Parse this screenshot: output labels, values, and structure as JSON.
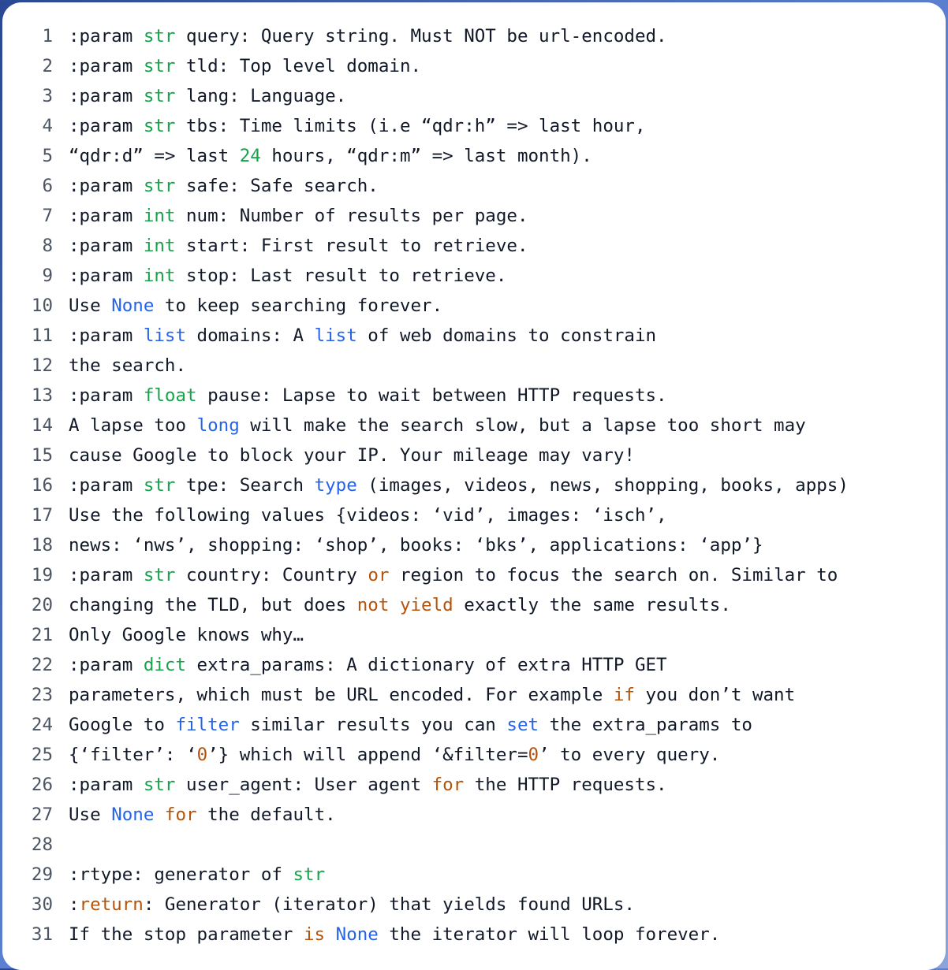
{
  "lines": [
    {
      "n": "1",
      "tokens": [
        {
          "t": ":param ",
          "c": ""
        },
        {
          "t": "str",
          "c": "tk-kw"
        },
        {
          "t": " query: Query string. Must NOT be url-encoded.",
          "c": ""
        }
      ]
    },
    {
      "n": "2",
      "tokens": [
        {
          "t": ":param ",
          "c": ""
        },
        {
          "t": "str",
          "c": "tk-kw"
        },
        {
          "t": " tld: Top level domain.",
          "c": ""
        }
      ]
    },
    {
      "n": "3",
      "tokens": [
        {
          "t": ":param ",
          "c": ""
        },
        {
          "t": "str",
          "c": "tk-kw"
        },
        {
          "t": " lang: Language.",
          "c": ""
        }
      ]
    },
    {
      "n": "4",
      "tokens": [
        {
          "t": ":param ",
          "c": ""
        },
        {
          "t": "str",
          "c": "tk-kw"
        },
        {
          "t": " tbs: Time limits (i.e “qdr:h” => last hour,",
          "c": ""
        }
      ]
    },
    {
      "n": "5",
      "tokens": [
        {
          "t": "“qdr:d” => last ",
          "c": ""
        },
        {
          "t": "24",
          "c": "tk-num"
        },
        {
          "t": " hours, “qdr:m” => last month).",
          "c": ""
        }
      ]
    },
    {
      "n": "6",
      "tokens": [
        {
          "t": ":param ",
          "c": ""
        },
        {
          "t": "str",
          "c": "tk-kw"
        },
        {
          "t": " safe: Safe search.",
          "c": ""
        }
      ]
    },
    {
      "n": "7",
      "tokens": [
        {
          "t": ":param ",
          "c": ""
        },
        {
          "t": "int",
          "c": "tk-kw"
        },
        {
          "t": " num: Number of results per page.",
          "c": ""
        }
      ]
    },
    {
      "n": "8",
      "tokens": [
        {
          "t": ":param ",
          "c": ""
        },
        {
          "t": "int",
          "c": "tk-kw"
        },
        {
          "t": " start: First result to retrieve.",
          "c": ""
        }
      ]
    },
    {
      "n": "9",
      "tokens": [
        {
          "t": ":param ",
          "c": ""
        },
        {
          "t": "int",
          "c": "tk-kw"
        },
        {
          "t": " stop: Last result to retrieve.",
          "c": ""
        }
      ]
    },
    {
      "n": "10",
      "tokens": [
        {
          "t": "Use ",
          "c": ""
        },
        {
          "t": "None",
          "c": "tk-none"
        },
        {
          "t": " to keep searching forever.",
          "c": ""
        }
      ]
    },
    {
      "n": "11",
      "tokens": [
        {
          "t": ":param ",
          "c": ""
        },
        {
          "t": "list",
          "c": "tk-builtin"
        },
        {
          "t": " domains: A ",
          "c": ""
        },
        {
          "t": "list",
          "c": "tk-builtin"
        },
        {
          "t": " of web domains to constrain",
          "c": ""
        }
      ]
    },
    {
      "n": "12",
      "tokens": [
        {
          "t": "the search.",
          "c": ""
        }
      ]
    },
    {
      "n": "13",
      "tokens": [
        {
          "t": ":param ",
          "c": ""
        },
        {
          "t": "float",
          "c": "tk-kw"
        },
        {
          "t": " pause: Lapse to wait between HTTP requests.",
          "c": ""
        }
      ]
    },
    {
      "n": "14",
      "tokens": [
        {
          "t": "A lapse too ",
          "c": ""
        },
        {
          "t": "long",
          "c": "tk-builtin"
        },
        {
          "t": " will make the search slow, but a lapse too short may",
          "c": ""
        }
      ]
    },
    {
      "n": "15",
      "tokens": [
        {
          "t": "cause Google to block your IP. Your mileage may vary!",
          "c": ""
        }
      ]
    },
    {
      "n": "16",
      "tokens": [
        {
          "t": ":param ",
          "c": ""
        },
        {
          "t": "str",
          "c": "tk-kw"
        },
        {
          "t": " tpe: Search ",
          "c": ""
        },
        {
          "t": "type",
          "c": "tk-builtin"
        },
        {
          "t": " (images, videos, news, shopping, books, apps)",
          "c": ""
        }
      ]
    },
    {
      "n": "17",
      "tokens": [
        {
          "t": "Use the following values {videos: ‘vid’, images: ‘isch’,",
          "c": ""
        }
      ]
    },
    {
      "n": "18",
      "tokens": [
        {
          "t": "news: ‘nws’, shopping: ‘shop’, books: ‘bks’, applications: ‘app’}",
          "c": ""
        }
      ]
    },
    {
      "n": "19",
      "tokens": [
        {
          "t": ":param ",
          "c": ""
        },
        {
          "t": "str",
          "c": "tk-kw"
        },
        {
          "t": " country: Country ",
          "c": ""
        },
        {
          "t": "or",
          "c": "tk-op"
        },
        {
          "t": " region to focus the search on. Similar to",
          "c": ""
        }
      ]
    },
    {
      "n": "20",
      "tokens": [
        {
          "t": "changing the TLD, but does ",
          "c": ""
        },
        {
          "t": "not",
          "c": "tk-op"
        },
        {
          "t": " ",
          "c": ""
        },
        {
          "t": "yield",
          "c": "tk-op"
        },
        {
          "t": " exactly the same results.",
          "c": ""
        }
      ]
    },
    {
      "n": "21",
      "tokens": [
        {
          "t": "Only Google knows why…",
          "c": ""
        }
      ]
    },
    {
      "n": "22",
      "tokens": [
        {
          "t": ":param ",
          "c": ""
        },
        {
          "t": "dict",
          "c": "tk-kw"
        },
        {
          "t": " extra_params: A dictionary of extra HTTP GET",
          "c": ""
        }
      ]
    },
    {
      "n": "23",
      "tokens": [
        {
          "t": "parameters, which must be URL encoded. For example ",
          "c": ""
        },
        {
          "t": "if",
          "c": "tk-op"
        },
        {
          "t": " you don’t want",
          "c": ""
        }
      ]
    },
    {
      "n": "24",
      "tokens": [
        {
          "t": "Google to ",
          "c": ""
        },
        {
          "t": "filter",
          "c": "tk-builtin"
        },
        {
          "t": " similar results you can ",
          "c": ""
        },
        {
          "t": "set",
          "c": "tk-builtin"
        },
        {
          "t": " the extra_params to",
          "c": ""
        }
      ]
    },
    {
      "n": "25",
      "tokens": [
        {
          "t": "{‘filter’: ‘",
          "c": ""
        },
        {
          "t": "0",
          "c": "tk-lit0"
        },
        {
          "t": "’} which will append ‘&filter=",
          "c": ""
        },
        {
          "t": "0",
          "c": "tk-lit0"
        },
        {
          "t": "’ to every query.",
          "c": ""
        }
      ]
    },
    {
      "n": "26",
      "tokens": [
        {
          "t": ":param ",
          "c": ""
        },
        {
          "t": "str",
          "c": "tk-kw"
        },
        {
          "t": " user_agent: User agent ",
          "c": ""
        },
        {
          "t": "for",
          "c": "tk-op"
        },
        {
          "t": " the HTTP requests.",
          "c": ""
        }
      ]
    },
    {
      "n": "27",
      "tokens": [
        {
          "t": "Use ",
          "c": ""
        },
        {
          "t": "None",
          "c": "tk-none"
        },
        {
          "t": " ",
          "c": ""
        },
        {
          "t": "for",
          "c": "tk-op"
        },
        {
          "t": " the default.",
          "c": ""
        }
      ]
    },
    {
      "n": "28",
      "tokens": [
        {
          "t": "",
          "c": ""
        }
      ]
    },
    {
      "n": "29",
      "tokens": [
        {
          "t": ":rtype: generator of ",
          "c": ""
        },
        {
          "t": "str",
          "c": "tk-kw"
        }
      ]
    },
    {
      "n": "30",
      "tokens": [
        {
          "t": ":",
          "c": ""
        },
        {
          "t": "return",
          "c": "tk-ret"
        },
        {
          "t": ": Generator (iterator) that yields found URLs.",
          "c": ""
        }
      ]
    },
    {
      "n": "31",
      "tokens": [
        {
          "t": "If the stop parameter ",
          "c": ""
        },
        {
          "t": "is",
          "c": "tk-op"
        },
        {
          "t": " ",
          "c": ""
        },
        {
          "t": "None",
          "c": "tk-none"
        },
        {
          "t": " the iterator will loop forever.",
          "c": ""
        }
      ]
    }
  ]
}
